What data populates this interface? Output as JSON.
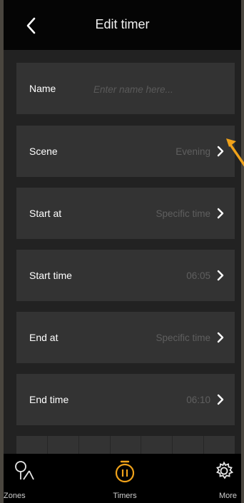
{
  "header": {
    "title": "Edit timer",
    "back_icon": "chevron-left-icon"
  },
  "form": {
    "name": {
      "label": "Name",
      "value": "",
      "placeholder": "Enter name here..."
    },
    "scene": {
      "label": "Scene",
      "value": "Evening"
    },
    "start_at": {
      "label": "Start at",
      "value": "Specific time"
    },
    "start_time": {
      "label": "Start time",
      "value": "06:05"
    },
    "end_at": {
      "label": "End at",
      "value": "Specific time"
    },
    "end_time": {
      "label": "End time",
      "value": "06:10"
    }
  },
  "tabbar": {
    "zones": {
      "label": "Zones",
      "icon": "zones-icon"
    },
    "timers": {
      "label": "Timers",
      "icon": "stopwatch-icon",
      "active": true
    },
    "more": {
      "label": "More",
      "icon": "gear-icon"
    }
  },
  "colors": {
    "accent": "#f0a21a",
    "background": "#222222",
    "row": "#333333",
    "value_text": "#5f5f5f",
    "annotation_arrow": "#f0a21a"
  }
}
